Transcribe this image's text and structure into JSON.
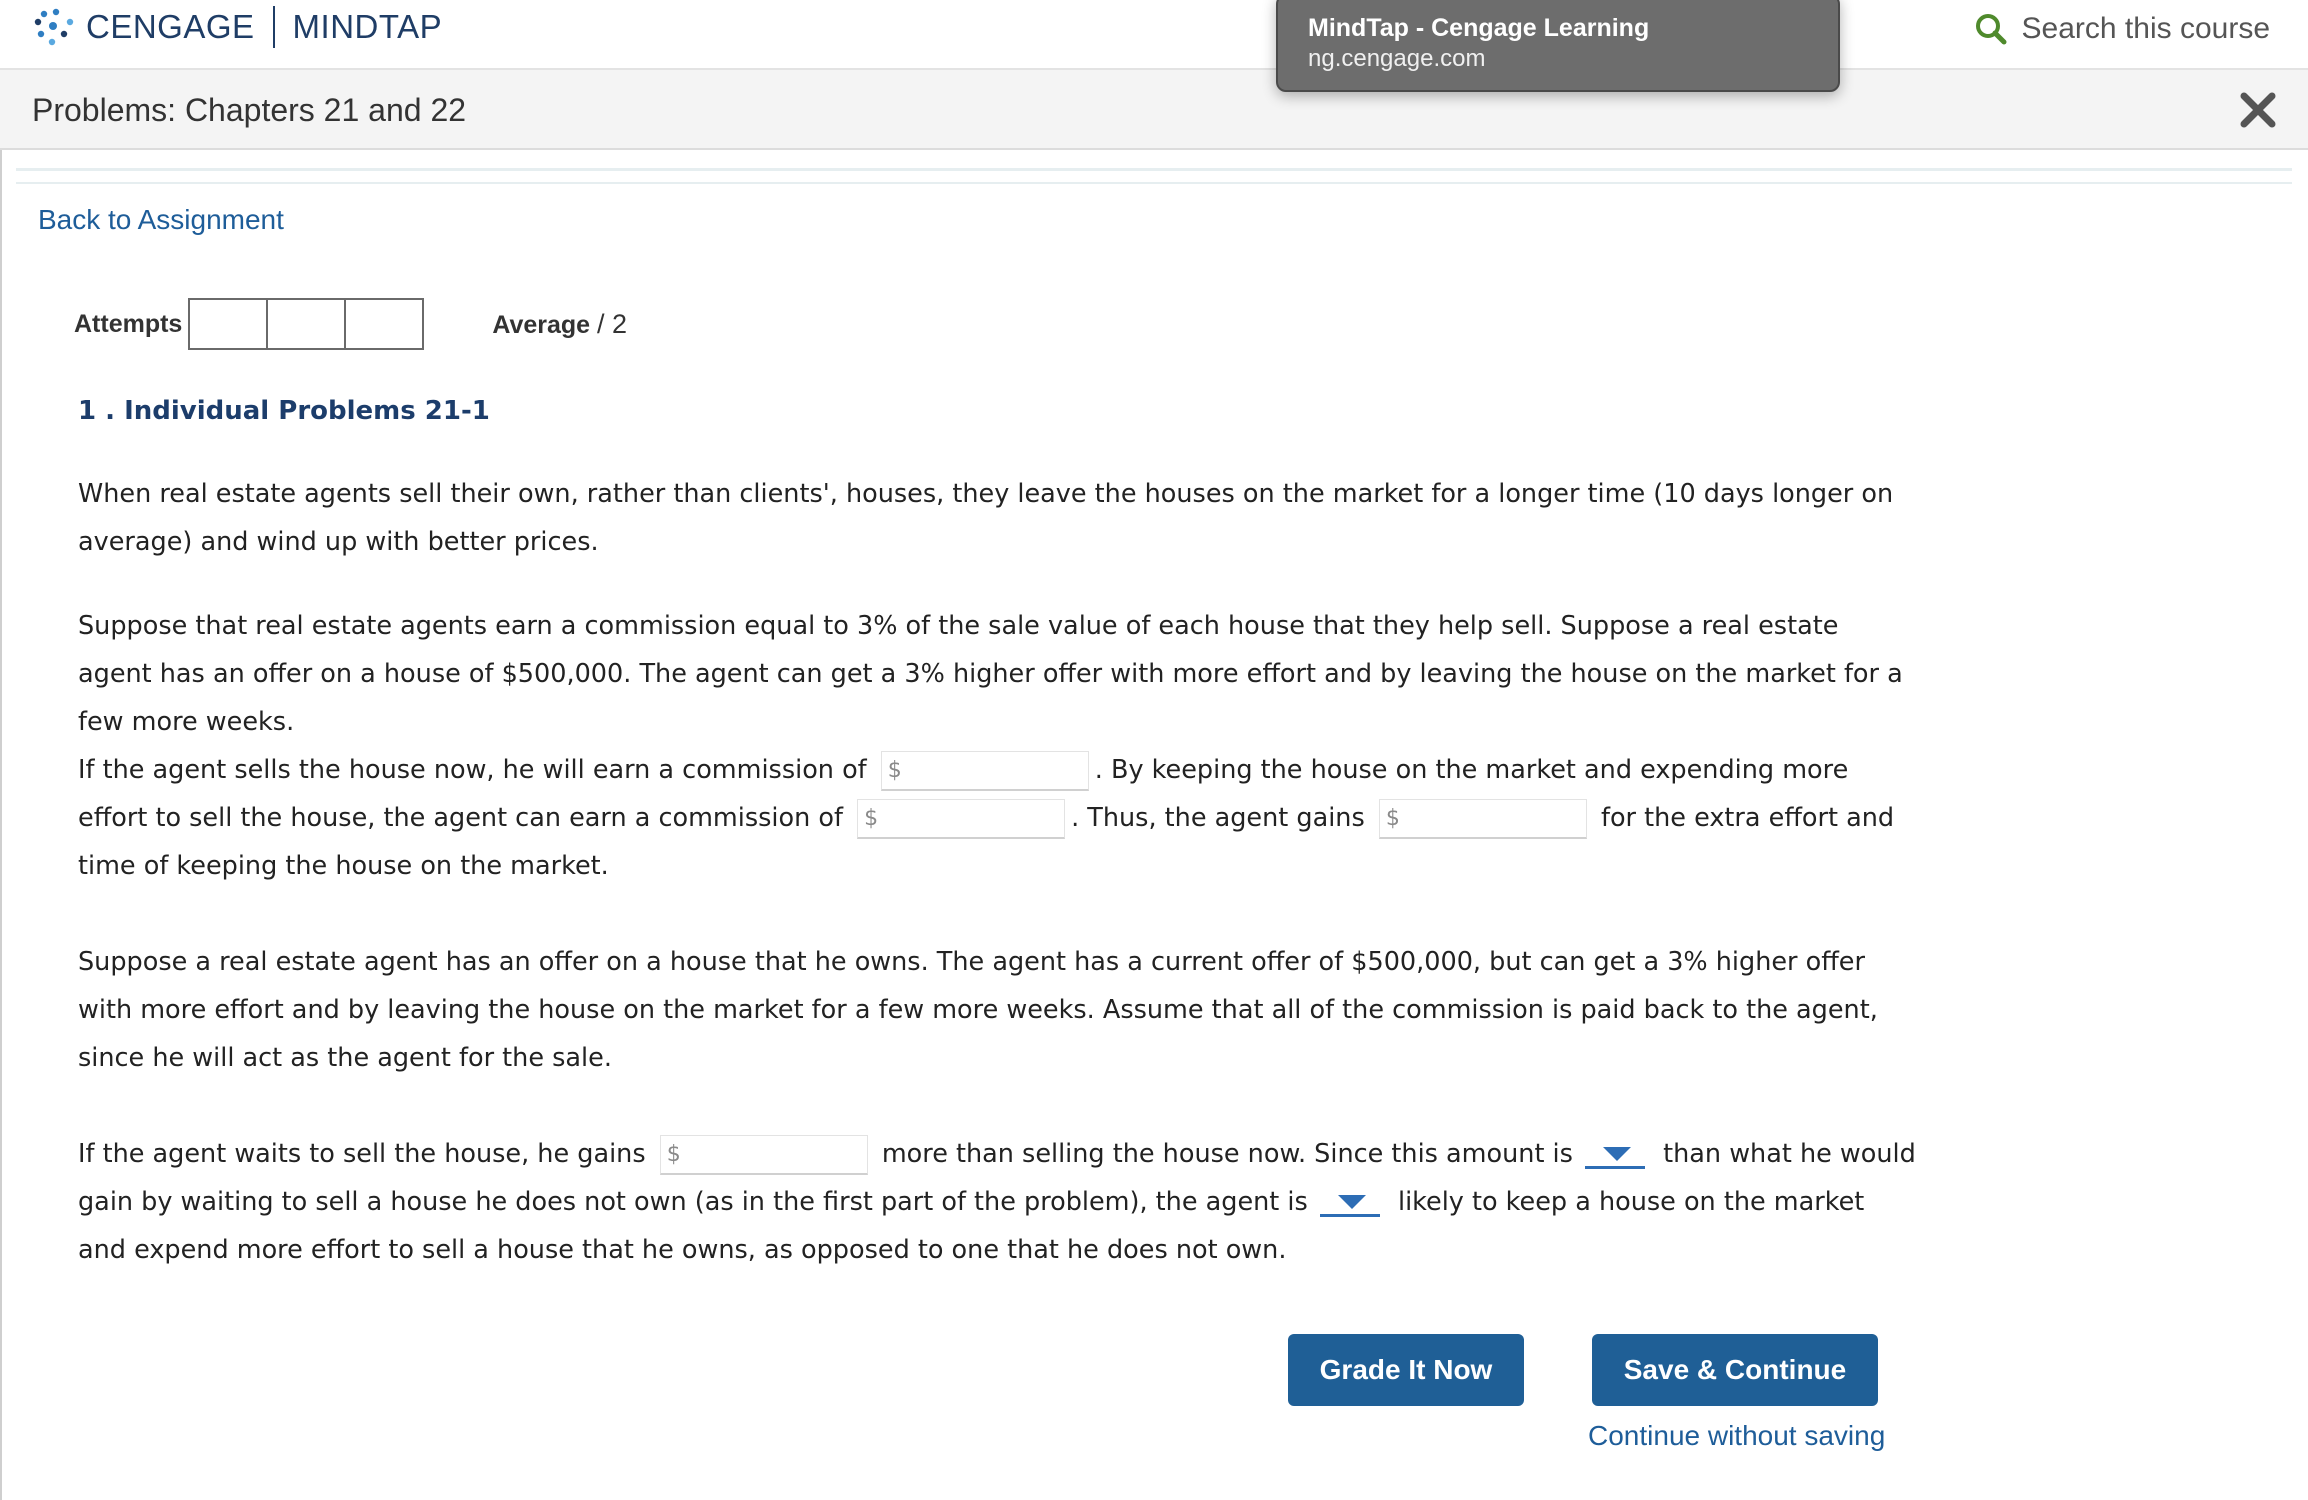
{
  "header": {
    "brand_name": "CENGAGE",
    "product_name": "MINDTAP",
    "search_label": "Search this course"
  },
  "tooltip": {
    "title": "MindTap - Cengage Learning",
    "url": "ng.cengage.com"
  },
  "titlebar": {
    "title": "Problems: Chapters 21 and 22",
    "close_label": "×"
  },
  "nav": {
    "back_link": "Back to Assignment"
  },
  "scoring": {
    "attempts_label": "Attempts",
    "attempt_boxes": [
      "",
      "",
      ""
    ],
    "average_label": "Average",
    "average_value": "/ 2"
  },
  "problem": {
    "heading": "1 . Individual Problems 21-1",
    "p1": "When real estate agents sell their own, rather than clients', houses, they leave the houses on the market for a longer time (10 days longer on average) and wind up with better prices.",
    "p2": "Suppose that real estate agents earn a commission equal to 3% of the sale value of each house that they help sell. Suppose a real estate agent has an offer on a house of $500,000. The agent can get a 3% higher offer with more effort and by leaving the house on the market for a few more weeks.",
    "p3_a": "If the agent sells the house now, he will earn a commission of",
    "p3_b": ". By keeping the house on the market and expending more effort to sell the house, the agent can earn a commission of",
    "p3_c": ". Thus, the agent gains",
    "p3_d": "for the extra effort and time of keeping the house on the market.",
    "p4": "Suppose a real estate agent has an offer on a house that he owns. The agent has a current offer of $500,000, but can get a 3% higher offer with more effort and by leaving the house on the market for a few more weeks. Assume that all of the commission is paid back to the agent, since he will act as the agent for the sale.",
    "p5_a": "If the agent waits to sell the house, he gains",
    "p5_b": "more than selling the house now. Since this amount is",
    "p5_c": "than what he would gain by waiting to sell a house he does not own (as in the first part of the problem), the agent is",
    "p5_d": "likely to keep a house on the market and expend more effort to sell a house that he owns, as opposed to one that he does not own.",
    "currency_symbol": "$",
    "inputs": {
      "commission_now": "",
      "commission_later": "",
      "agent_gains": "",
      "own_house_gains": ""
    },
    "dropdowns": {
      "comparison": "",
      "likelihood": ""
    }
  },
  "actions": {
    "grade_button": "Grade It Now",
    "save_button": "Save & Continue",
    "continue_link": "Continue without saving"
  },
  "colors": {
    "brand": "#1f3d66",
    "link": "#1e5d99",
    "button": "#1f5f96",
    "search_icon": "#4f8a2c",
    "dropdown": "#2d6db5"
  }
}
